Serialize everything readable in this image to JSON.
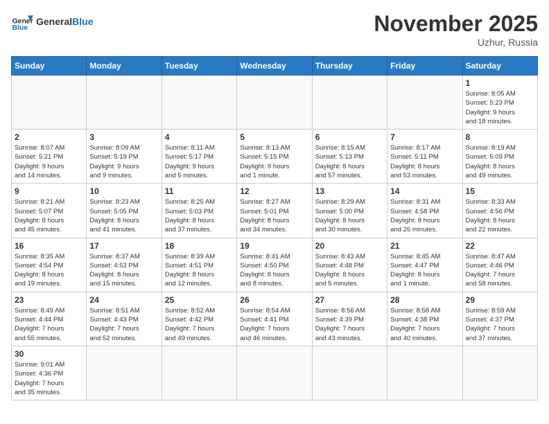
{
  "logo": {
    "text_general": "General",
    "text_blue": "Blue"
  },
  "header": {
    "month_year": "November 2025",
    "location": "Uzhur, Russia"
  },
  "weekdays": [
    "Sunday",
    "Monday",
    "Tuesday",
    "Wednesday",
    "Thursday",
    "Friday",
    "Saturday"
  ],
  "weeks": [
    [
      {
        "day": "",
        "info": ""
      },
      {
        "day": "",
        "info": ""
      },
      {
        "day": "",
        "info": ""
      },
      {
        "day": "",
        "info": ""
      },
      {
        "day": "",
        "info": ""
      },
      {
        "day": "",
        "info": ""
      },
      {
        "day": "1",
        "info": "Sunrise: 8:05 AM\nSunset: 5:23 PM\nDaylight: 9 hours\nand 18 minutes."
      }
    ],
    [
      {
        "day": "2",
        "info": "Sunrise: 8:07 AM\nSunset: 5:21 PM\nDaylight: 9 hours\nand 14 minutes."
      },
      {
        "day": "3",
        "info": "Sunrise: 8:09 AM\nSunset: 5:19 PM\nDaylight: 9 hours\nand 9 minutes."
      },
      {
        "day": "4",
        "info": "Sunrise: 8:11 AM\nSunset: 5:17 PM\nDaylight: 9 hours\nand 5 minutes."
      },
      {
        "day": "5",
        "info": "Sunrise: 8:13 AM\nSunset: 5:15 PM\nDaylight: 9 hours\nand 1 minute."
      },
      {
        "day": "6",
        "info": "Sunrise: 8:15 AM\nSunset: 5:13 PM\nDaylight: 8 hours\nand 57 minutes."
      },
      {
        "day": "7",
        "info": "Sunrise: 8:17 AM\nSunset: 5:11 PM\nDaylight: 8 hours\nand 53 minutes."
      },
      {
        "day": "8",
        "info": "Sunrise: 8:19 AM\nSunset: 5:09 PM\nDaylight: 8 hours\nand 49 minutes."
      }
    ],
    [
      {
        "day": "9",
        "info": "Sunrise: 8:21 AM\nSunset: 5:07 PM\nDaylight: 8 hours\nand 45 minutes."
      },
      {
        "day": "10",
        "info": "Sunrise: 8:23 AM\nSunset: 5:05 PM\nDaylight: 8 hours\nand 41 minutes."
      },
      {
        "day": "11",
        "info": "Sunrise: 8:25 AM\nSunset: 5:03 PM\nDaylight: 8 hours\nand 37 minutes."
      },
      {
        "day": "12",
        "info": "Sunrise: 8:27 AM\nSunset: 5:01 PM\nDaylight: 8 hours\nand 34 minutes."
      },
      {
        "day": "13",
        "info": "Sunrise: 8:29 AM\nSunset: 5:00 PM\nDaylight: 8 hours\nand 30 minutes."
      },
      {
        "day": "14",
        "info": "Sunrise: 8:31 AM\nSunset: 4:58 PM\nDaylight: 8 hours\nand 26 minutes."
      },
      {
        "day": "15",
        "info": "Sunrise: 8:33 AM\nSunset: 4:56 PM\nDaylight: 8 hours\nand 22 minutes."
      }
    ],
    [
      {
        "day": "16",
        "info": "Sunrise: 8:35 AM\nSunset: 4:54 PM\nDaylight: 8 hours\nand 19 minutes."
      },
      {
        "day": "17",
        "info": "Sunrise: 8:37 AM\nSunset: 4:53 PM\nDaylight: 8 hours\nand 15 minutes."
      },
      {
        "day": "18",
        "info": "Sunrise: 8:39 AM\nSunset: 4:51 PM\nDaylight: 8 hours\nand 12 minutes."
      },
      {
        "day": "19",
        "info": "Sunrise: 8:41 AM\nSunset: 4:50 PM\nDaylight: 8 hours\nand 8 minutes."
      },
      {
        "day": "20",
        "info": "Sunrise: 8:43 AM\nSunset: 4:48 PM\nDaylight: 8 hours\nand 5 minutes."
      },
      {
        "day": "21",
        "info": "Sunrise: 8:45 AM\nSunset: 4:47 PM\nDaylight: 8 hours\nand 1 minute."
      },
      {
        "day": "22",
        "info": "Sunrise: 8:47 AM\nSunset: 4:46 PM\nDaylight: 7 hours\nand 58 minutes."
      }
    ],
    [
      {
        "day": "23",
        "info": "Sunrise: 8:49 AM\nSunset: 4:44 PM\nDaylight: 7 hours\nand 55 minutes."
      },
      {
        "day": "24",
        "info": "Sunrise: 8:51 AM\nSunset: 4:43 PM\nDaylight: 7 hours\nand 52 minutes."
      },
      {
        "day": "25",
        "info": "Sunrise: 8:52 AM\nSunset: 4:42 PM\nDaylight: 7 hours\nand 49 minutes."
      },
      {
        "day": "26",
        "info": "Sunrise: 8:54 AM\nSunset: 4:41 PM\nDaylight: 7 hours\nand 46 minutes."
      },
      {
        "day": "27",
        "info": "Sunrise: 8:56 AM\nSunset: 4:39 PM\nDaylight: 7 hours\nand 43 minutes."
      },
      {
        "day": "28",
        "info": "Sunrise: 8:58 AM\nSunset: 4:38 PM\nDaylight: 7 hours\nand 40 minutes."
      },
      {
        "day": "29",
        "info": "Sunrise: 8:59 AM\nSunset: 4:37 PM\nDaylight: 7 hours\nand 37 minutes."
      }
    ],
    [
      {
        "day": "30",
        "info": "Sunrise: 9:01 AM\nSunset: 4:36 PM\nDaylight: 7 hours\nand 35 minutes."
      },
      {
        "day": "",
        "info": ""
      },
      {
        "day": "",
        "info": ""
      },
      {
        "day": "",
        "info": ""
      },
      {
        "day": "",
        "info": ""
      },
      {
        "day": "",
        "info": ""
      },
      {
        "day": "",
        "info": ""
      }
    ]
  ]
}
